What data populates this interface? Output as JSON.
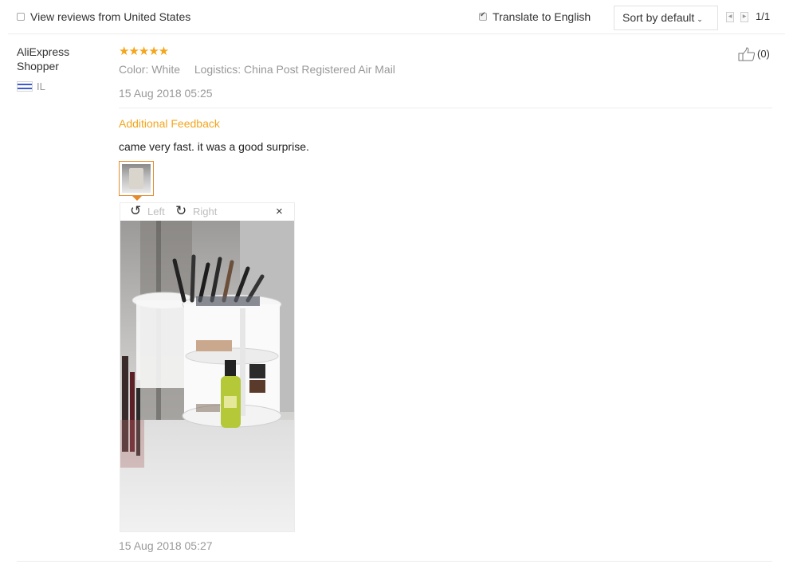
{
  "filters": {
    "view_from_label": "View reviews from United States",
    "view_from_checked": false,
    "translate_label": "Translate to English",
    "translate_checked": true,
    "sort_label": "Sort by default",
    "page_indicator": "1/1"
  },
  "review": {
    "user_name": "AliExpress Shopper",
    "country_code": "IL",
    "rating": 5,
    "stars_text": "★★★★★",
    "color_label": "Color: White",
    "logistics_label": "Logistics: China Post Registered Air Mail",
    "date": "15 Aug 2018 05:25",
    "helpful_count": "(0)",
    "additional_heading": "Additional Feedback",
    "additional_text": "came very fast. it was a good surprise.",
    "additional_date": "15 Aug 2018 05:27",
    "viewer": {
      "rotate_left_label": "Left",
      "rotate_right_label": "Right",
      "close_symbol": "×"
    }
  },
  "icons": {
    "thumbs_up": "thumbs-up-icon",
    "rotate_left": "rotate-left-icon",
    "rotate_right": "rotate-right-icon",
    "close": "close-icon",
    "flag": "israel-flag-icon"
  },
  "colors": {
    "accent_orange": "#f4a51c",
    "thumb_border": "#e48b2c",
    "muted_text": "#999999"
  }
}
